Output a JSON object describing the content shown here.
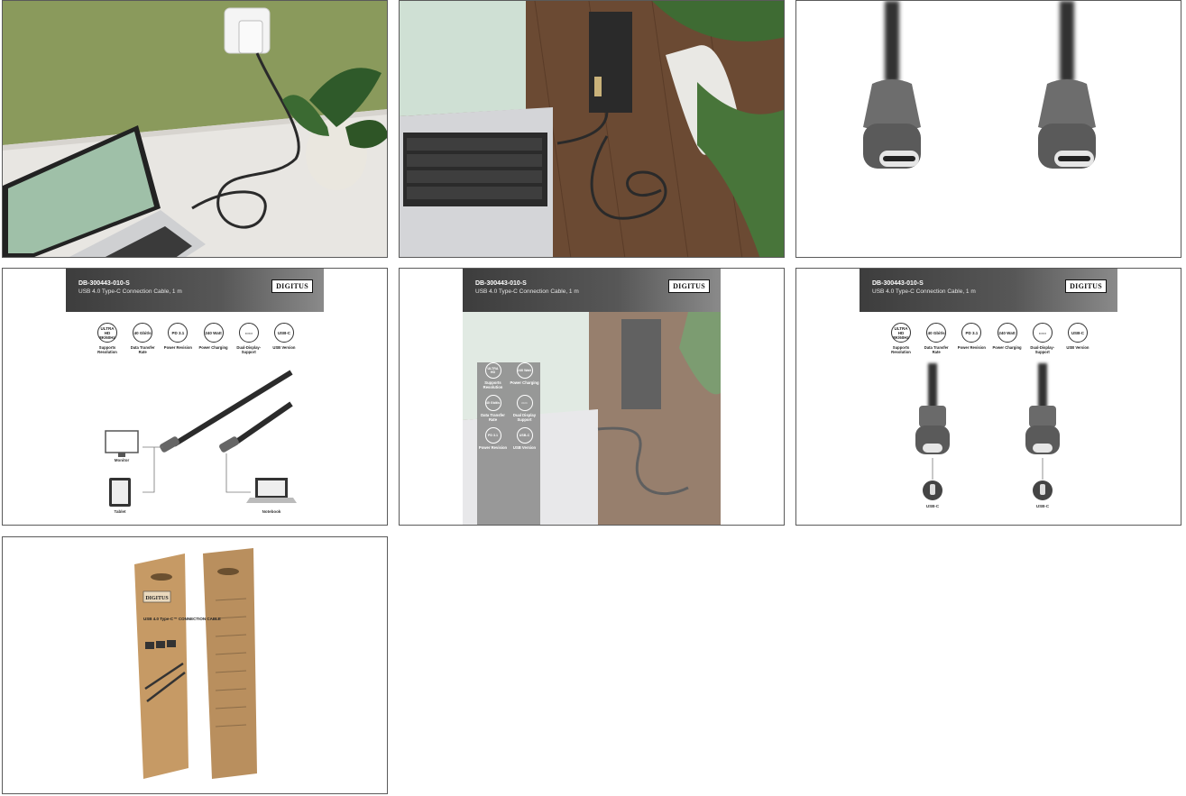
{
  "infographic": {
    "sku": "DB-300443-010-S",
    "description": "USB 4.0 Type-C Connection Cable, 1 m",
    "brand": "DIGITUS",
    "features": [
      {
        "icon_text": "ULTRA HD 8K/60Hz",
        "label": "Supports Resolution"
      },
      {
        "icon_text": "40 Gbit/s",
        "label": "Data Transfer Rate"
      },
      {
        "icon_text": "PD 3.1",
        "label": "Power Revision"
      },
      {
        "icon_text": "240 Watt",
        "label": "Power Charging"
      },
      {
        "icon_text": "",
        "label": "Dual-Display-Support"
      },
      {
        "icon_text": "USB-C",
        "label": "USB Version"
      }
    ],
    "devices": {
      "monitor": "Monitor",
      "tablet": "Tablet",
      "notebook": "Notebook"
    },
    "connector_label": "USB-C"
  },
  "overlay_features": [
    {
      "icon_text": "ULTRA HD",
      "label": "Supports Resolution"
    },
    {
      "icon_text": "240 Watt",
      "label": "Power Charging"
    },
    {
      "icon_text": "40 Gbit/s",
      "label": "Data Transfer Rate"
    },
    {
      "icon_text": "",
      "label": "Dual Display Support"
    },
    {
      "icon_text": "PD 3.1",
      "label": "Power Revision"
    },
    {
      "icon_text": "USB-C",
      "label": "USB Version"
    }
  ],
  "package": {
    "brand": "DIGITUS",
    "title": "USB 4.0 Type-C™ CONNECTION CABLE"
  },
  "colors": {
    "wall_green": "#8a9a5c",
    "wood": "#6b4a33",
    "banner_dark": "#4a4a4a",
    "kraft": "#c69a65"
  }
}
